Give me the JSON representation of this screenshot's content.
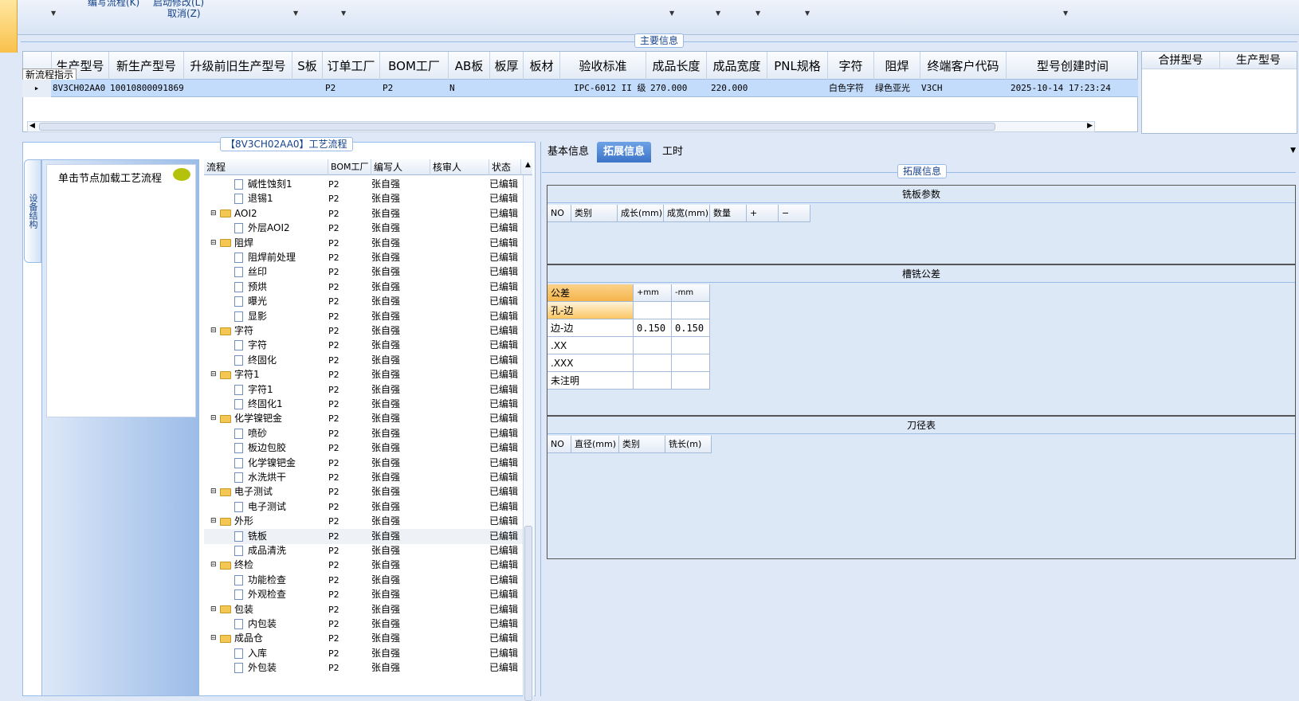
{
  "toolbar": {
    "item1": "编写流程(K)",
    "item2": "启动修改(L)",
    "item3": "取消(Z)"
  },
  "main_info": {
    "title": "主要信息",
    "columns": [
      "生产型号",
      "新生产型号",
      "升级前旧生产型号",
      "S板",
      "订单工厂",
      "BOM工厂",
      "AB板",
      "板厚",
      "板材",
      "验收标准",
      "成品长度",
      "成品宽度",
      "PNL规格",
      "字符",
      "阻焊",
      "终端客户代码",
      "型号创建时间"
    ],
    "tooltip": "新流程指示",
    "row": {
      "prod": "8V3CH02AA0",
      "new_prod": "10010800091869",
      "order_factory": "P2",
      "bom_factory": "P2",
      "ab": "N",
      "standard": "IPC-6012 II 级",
      "length": "270.000",
      "width": "220.000",
      "char": "白色字符",
      "solder": "绿色亚光",
      "customer": "V3CH",
      "created": "2025-10-14 17:23:24"
    },
    "right_columns": [
      "合拼型号",
      "生产型号"
    ]
  },
  "process": {
    "title": "【8V3CH02AA0】工艺流程",
    "vtab": "设备结构",
    "load_hint": "单击节点加载工艺流程",
    "columns": [
      "流程",
      "BOM工厂",
      "编写人",
      "核审人",
      "状态"
    ],
    "rows": [
      {
        "level": 2,
        "name": "碱性蚀刻1",
        "bom": "P2",
        "author": "张自强",
        "status": "已编辑"
      },
      {
        "level": 2,
        "name": "退锡1",
        "bom": "P2",
        "author": "张自强",
        "status": "已编辑"
      },
      {
        "level": 1,
        "name": "AOI2",
        "bom": "P2",
        "author": "张自强",
        "status": "已编辑"
      },
      {
        "level": 2,
        "name": "外层AOI2",
        "bom": "P2",
        "author": "张自强",
        "status": "已编辑"
      },
      {
        "level": 1,
        "name": "阻焊",
        "bom": "P2",
        "author": "张自强",
        "status": "已编辑"
      },
      {
        "level": 2,
        "name": "阻焊前处理",
        "bom": "P2",
        "author": "张自强",
        "status": "已编辑"
      },
      {
        "level": 2,
        "name": "丝印",
        "bom": "P2",
        "author": "张自强",
        "status": "已编辑"
      },
      {
        "level": 2,
        "name": "预烘",
        "bom": "P2",
        "author": "张自强",
        "status": "已编辑"
      },
      {
        "level": 2,
        "name": "曝光",
        "bom": "P2",
        "author": "张自强",
        "status": "已编辑"
      },
      {
        "level": 2,
        "name": "显影",
        "bom": "P2",
        "author": "张自强",
        "status": "已编辑"
      },
      {
        "level": 1,
        "name": "字符",
        "bom": "P2",
        "author": "张自强",
        "status": "已编辑"
      },
      {
        "level": 2,
        "name": "字符",
        "bom": "P2",
        "author": "张自强",
        "status": "已编辑"
      },
      {
        "level": 2,
        "name": "终固化",
        "bom": "P2",
        "author": "张自强",
        "status": "已编辑"
      },
      {
        "level": 1,
        "name": "字符1",
        "bom": "P2",
        "author": "张自强",
        "status": "已编辑"
      },
      {
        "level": 2,
        "name": "字符1",
        "bom": "P2",
        "author": "张自强",
        "status": "已编辑"
      },
      {
        "level": 2,
        "name": "终固化1",
        "bom": "P2",
        "author": "张自强",
        "status": "已编辑"
      },
      {
        "level": 1,
        "name": "化学镍钯金",
        "bom": "P2",
        "author": "张自强",
        "status": "已编辑"
      },
      {
        "level": 2,
        "name": "喷砂",
        "bom": "P2",
        "author": "张自强",
        "status": "已编辑"
      },
      {
        "level": 2,
        "name": "板边包胶",
        "bom": "P2",
        "author": "张自强",
        "status": "已编辑"
      },
      {
        "level": 2,
        "name": "化学镍钯金",
        "bom": "P2",
        "author": "张自强",
        "status": "已编辑"
      },
      {
        "level": 2,
        "name": "水洗烘干",
        "bom": "P2",
        "author": "张自强",
        "status": "已编辑"
      },
      {
        "level": 1,
        "name": "电子测试",
        "bom": "P2",
        "author": "张自强",
        "status": "已编辑"
      },
      {
        "level": 2,
        "name": "电子测试",
        "bom": "P2",
        "author": "张自强",
        "status": "已编辑"
      },
      {
        "level": 1,
        "name": "外形",
        "bom": "P2",
        "author": "张自强",
        "status": "已编辑"
      },
      {
        "level": 2,
        "name": "铣板",
        "bom": "P2",
        "author": "张自强",
        "status": "已编辑",
        "selected": true
      },
      {
        "level": 2,
        "name": "成品清洗",
        "bom": "P2",
        "author": "张自强",
        "status": "已编辑"
      },
      {
        "level": 1,
        "name": "终检",
        "bom": "P2",
        "author": "张自强",
        "status": "已编辑"
      },
      {
        "level": 2,
        "name": "功能检查",
        "bom": "P2",
        "author": "张自强",
        "status": "已编辑"
      },
      {
        "level": 2,
        "name": "外观检查",
        "bom": "P2",
        "author": "张自强",
        "status": "已编辑"
      },
      {
        "level": 1,
        "name": "包装",
        "bom": "P2",
        "author": "张自强",
        "status": "已编辑"
      },
      {
        "level": 2,
        "name": "内包装",
        "bom": "P2",
        "author": "张自强",
        "status": "已编辑"
      },
      {
        "level": 1,
        "name": "成品仓",
        "bom": "P2",
        "author": "张自强",
        "status": "已编辑"
      },
      {
        "level": 2,
        "name": "入库",
        "bom": "P2",
        "author": "张自强",
        "status": "已编辑"
      },
      {
        "level": 2,
        "name": "外包装",
        "bom": "P2",
        "author": "张自强",
        "status": "已编辑"
      }
    ]
  },
  "right": {
    "tabs": [
      "基本信息",
      "拓展信息",
      "工时"
    ],
    "group_title": "拓展信息",
    "milling": {
      "title": "铣板参数",
      "columns": [
        "NO",
        "类别",
        "成长(mm)",
        "成宽(mm)",
        "数量",
        "+",
        "−"
      ]
    },
    "tolerance": {
      "title": "槽铣公差",
      "columns": [
        "公差",
        "+mm",
        "-mm"
      ],
      "rows": [
        [
          "孔-边",
          "",
          ""
        ],
        [
          "边-边",
          "0.150",
          "0.150"
        ],
        [
          ".XX",
          "",
          ""
        ],
        [
          ".XXX",
          "",
          ""
        ],
        [
          "未注明",
          "",
          ""
        ]
      ]
    },
    "cutter": {
      "title": "刀径表",
      "columns": [
        "NO",
        "直径(mm)",
        "类别",
        "铣长(m)"
      ]
    }
  }
}
